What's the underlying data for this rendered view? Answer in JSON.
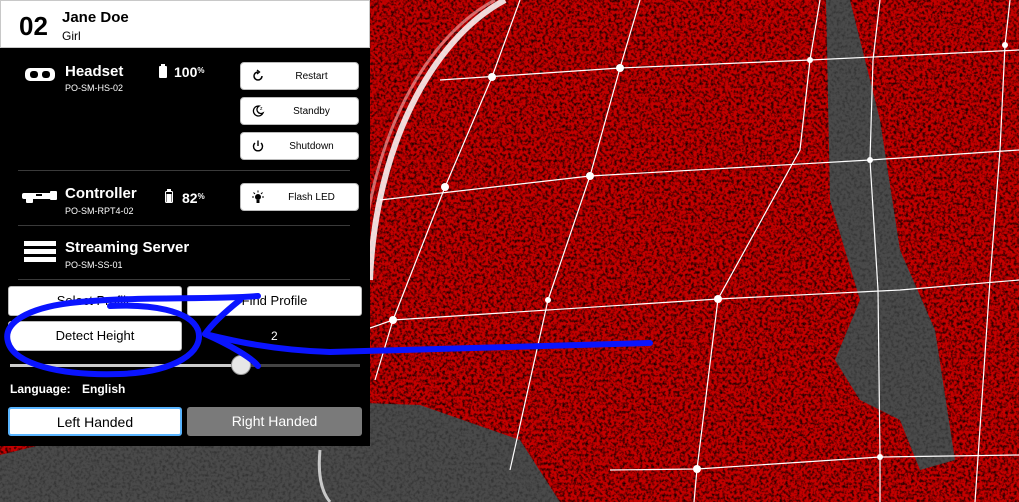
{
  "user": {
    "number": "02",
    "name": "Jane Doe",
    "gender": "Girl"
  },
  "devices": {
    "headset": {
      "icon": "vr-headset-icon",
      "title": "Headset",
      "id": "PO-SM-HS-02",
      "battery_value": "100",
      "battery_unit": "%",
      "battery_level": 1.0,
      "buttons": [
        {
          "label": "Restart",
          "icon": "restart-icon"
        },
        {
          "label": "Standby",
          "icon": "moon-icon"
        },
        {
          "label": "Shutdown",
          "icon": "power-icon"
        }
      ]
    },
    "controller": {
      "icon": "controller-icon",
      "title": "Controller",
      "id": "PO-SM-RPT4-02",
      "battery_value": "82",
      "battery_unit": "%",
      "battery_level": 0.82,
      "button": {
        "label": "Flash LED",
        "icon": "bulb-icon"
      }
    },
    "server": {
      "icon": "server-icon",
      "title": "Streaming Server",
      "id": "PO-SM-SS-01"
    }
  },
  "profile": {
    "select_label": "Select Profile",
    "find_label": "Find Profile"
  },
  "height": {
    "detect_label": "Detect Height",
    "slider_value": "2",
    "slider_fraction": 0.66
  },
  "language": {
    "label": "Language:",
    "value": "English"
  },
  "handedness": {
    "left_label": "Left Handed",
    "right_label": "Right Handed",
    "selected": "left"
  },
  "colors": {
    "background": "#b30000",
    "grid": "#ffffff",
    "annotation": "#0a14ff",
    "selected_border": "#5ab5ff"
  }
}
